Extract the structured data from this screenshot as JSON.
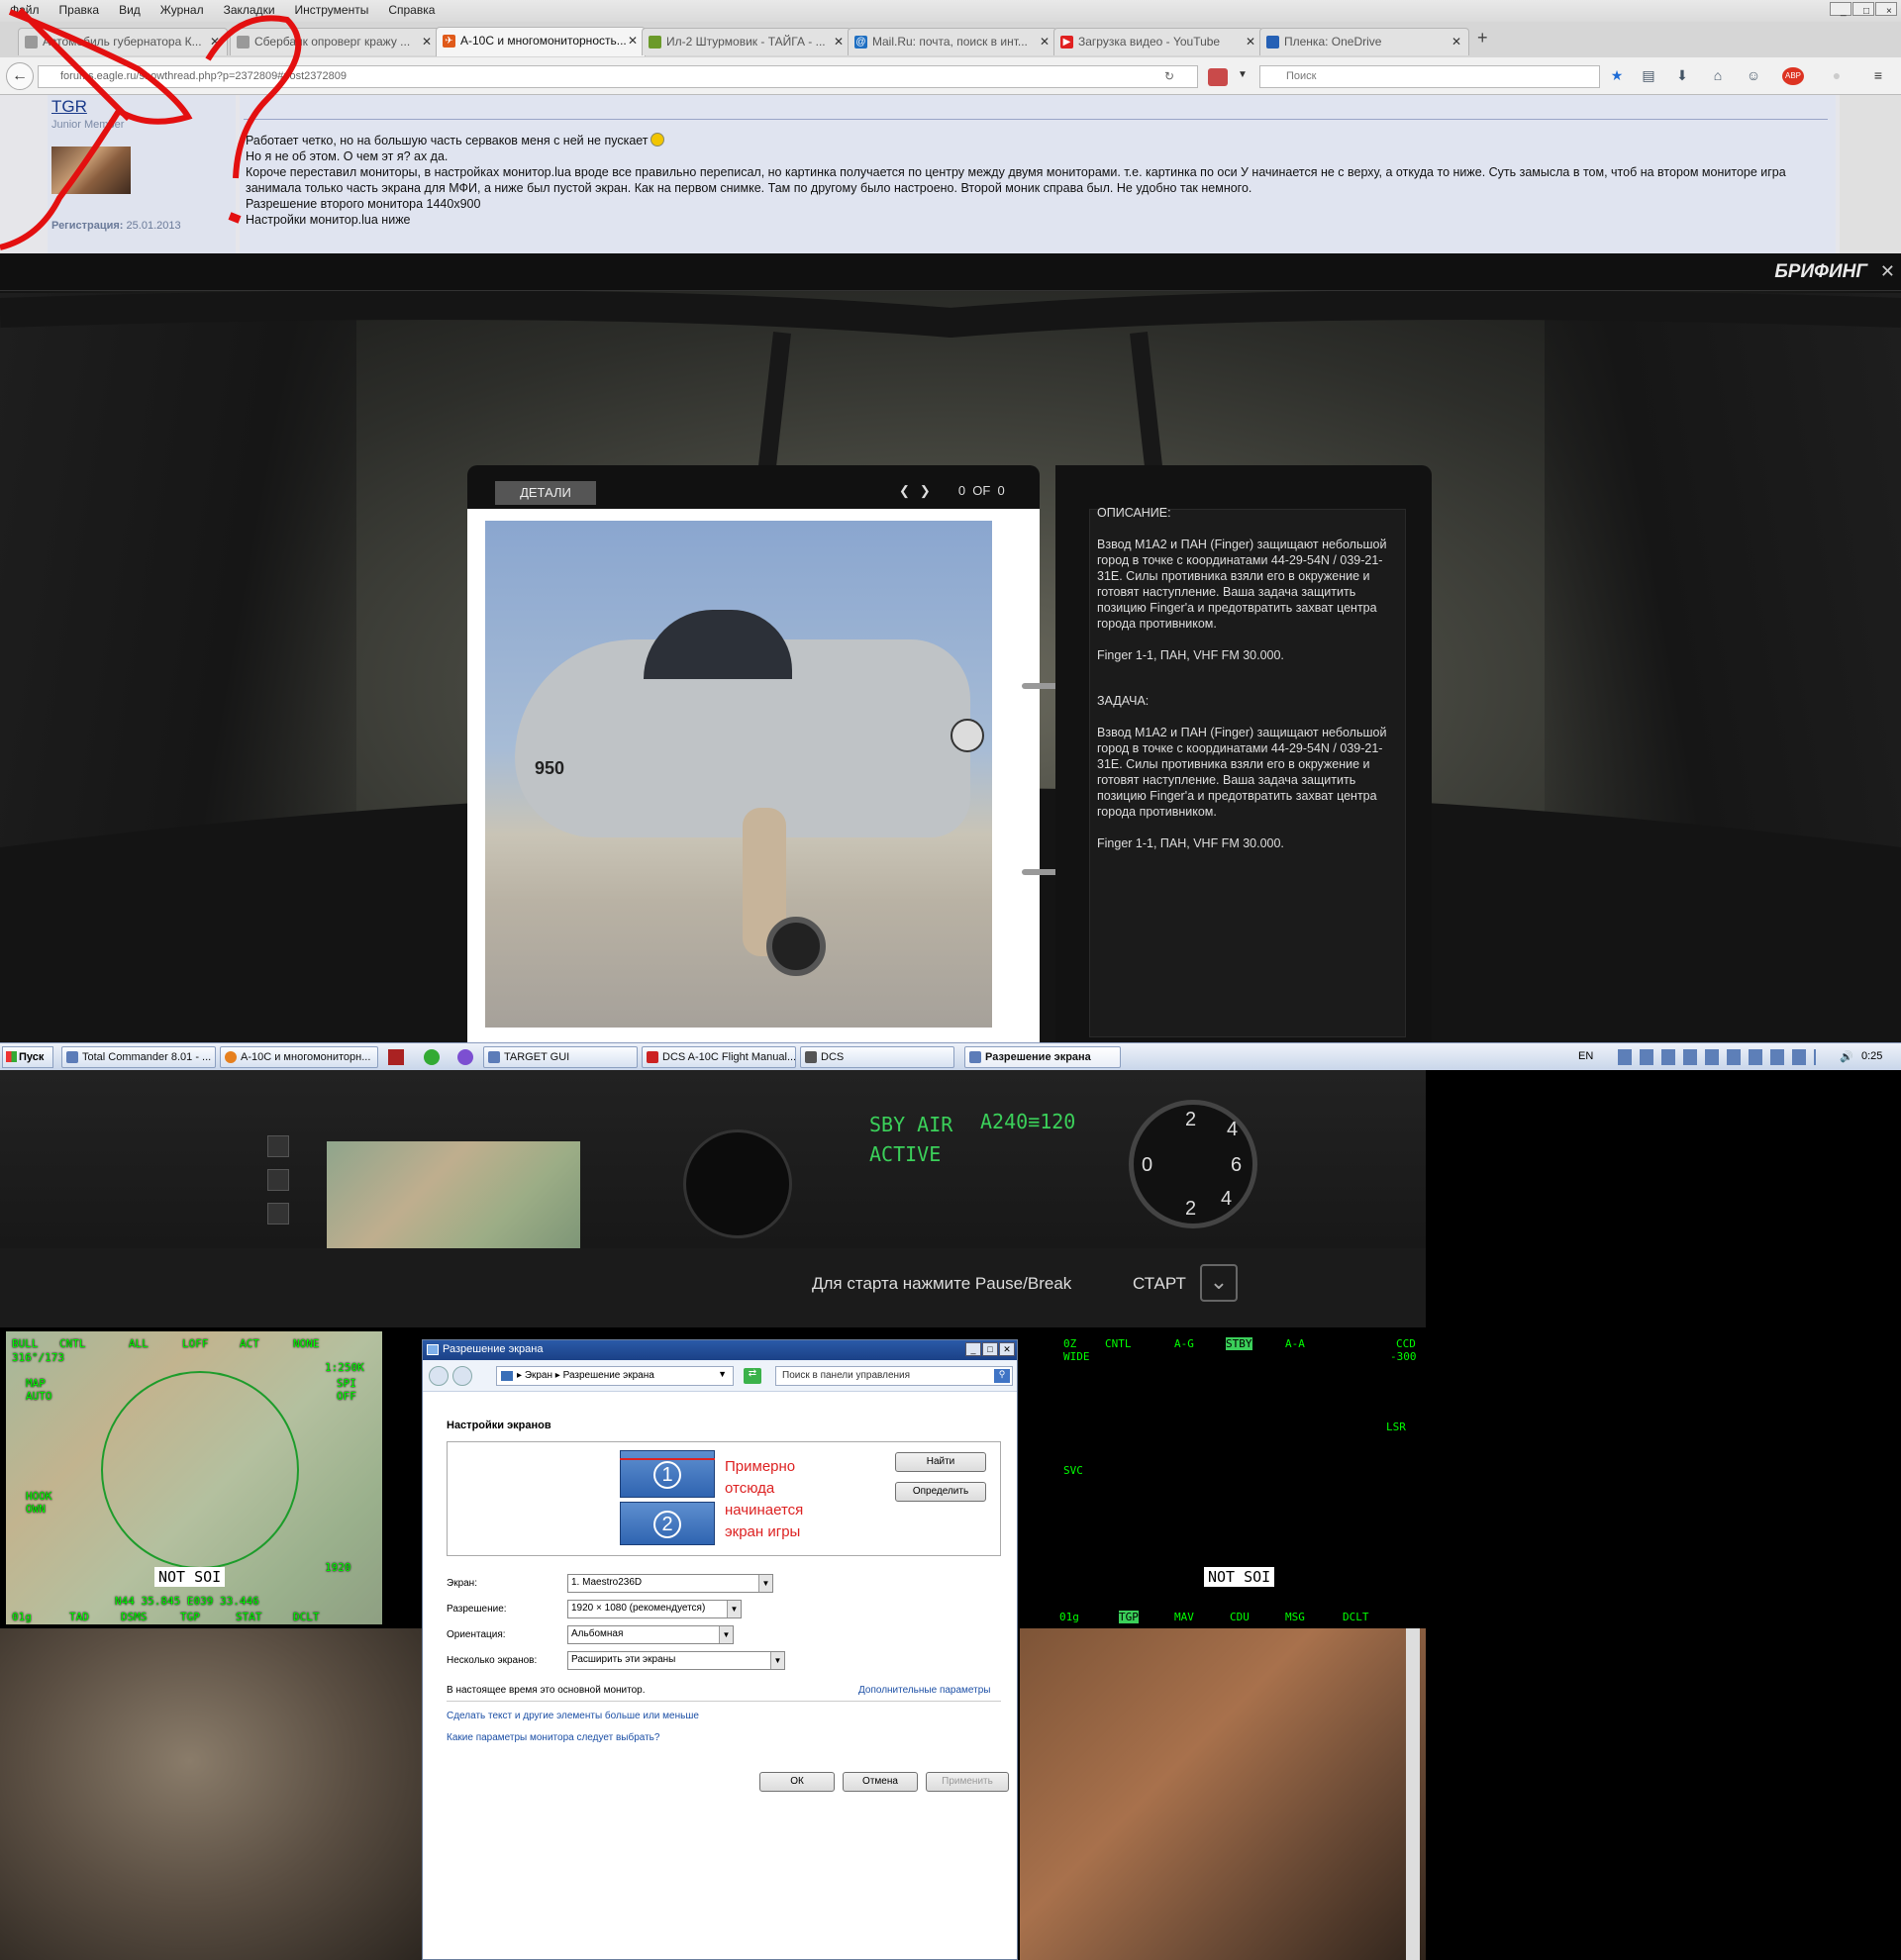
{
  "browser": {
    "menu": [
      "Файл",
      "Правка",
      "Вид",
      "Журнал",
      "Закладки",
      "Инструменты",
      "Справка"
    ],
    "tabs": [
      {
        "label": "Автомобиль губернатора К...",
        "icon": "page-icon"
      },
      {
        "label": "Сбербанк опроверг кражу ...",
        "icon": "page-icon"
      },
      {
        "label": "A-10C и многомониторность...",
        "icon": "eagle-icon",
        "active": true
      },
      {
        "label": "Ил-2 Штурмовик - ТАЙГА - ...",
        "icon": "gamepad-icon"
      },
      {
        "label": "Mail.Ru: почта, поиск в инт...",
        "icon": "mail-icon"
      },
      {
        "label": "Загрузка видео - YouTube",
        "icon": "youtube-icon"
      },
      {
        "label": "Пленка: OneDrive",
        "icon": "cloud-icon"
      }
    ],
    "url": "forums.eagle.ru/showthread.php?p=2372809#post2372809",
    "search_placeholder": "Поиск"
  },
  "forum": {
    "username": "TGR",
    "rank": "Junior Member",
    "reg_label": "Регистрация:",
    "reg_date": "25.01.2013",
    "post_lines": [
      "Работает четко, но на большую часть серваков меня с ней не пускает",
      "Но я не об этом. О чем эт я? ах да.",
      "Короче переставил мониторы, в настройках монитор.lua вроде все правильно переписал, но картинка получается по центру между двумя мониторами. т.е. картинка по оси У начинается не с верху, а откуда то ниже. Суть замысла в том, чтоб на втором мониторе игра занимала только часть экрана для МФИ, а ниже был пустой экран. Как на первом снимке. Там по другому было настроено. Второй моник справа был. Не удобно так немного.",
      "Разрешение второго монитора 1440x900",
      "Настройки монитор.lua ниже"
    ]
  },
  "game": {
    "briefing_title": "БРИФИНГ",
    "details_tab": "ДЕТАЛИ",
    "pager": "0  OF  0",
    "jet_number": "950",
    "description_heading": "ОПИСАНИЕ:",
    "description_text": "Взвод M1A2 и ПАН (Finger) защищают небольшой город в точке с координатами 44-29-54N / 039-21-31E. Силы противника взяли его в окружение и готовят наступление. Ваша задача защитить позицию Finger'a и предотвратить захват центра города противником.",
    "description_freq": "Finger 1-1, ПАН, VHF FM 30.000.",
    "task_heading": "ЗАДАЧА:",
    "task_text": "Взвод M1A2 и ПАН (Finger) защищают небольшой город в точке с координатами 44-29-54N / 039-21-31E. Силы противника взяли его в окружение и готовят наступление. Ваша задача защитить позицию Finger'a и предотвратить захват центра города противником.",
    "task_freq": "Finger 1-1, ПАН, VHF FM 30.000.",
    "start_hint": "Для старта нажмите Pause/Break",
    "start_label": "СТАРТ"
  },
  "taskbar": {
    "start": "Пуск",
    "items": [
      "Total Commander 8.01 - ...",
      "A-10C и многомониторн...",
      "TARGET GUI",
      "DCS A-10C Flight Manual...",
      "DCS",
      "Разрешение экрана"
    ],
    "lang": "EN",
    "clock": "0:25"
  },
  "cockpit": {
    "sby_line1": "SBY AIR",
    "sby_line2": "ACTIVE",
    "cmsp": "A240≡120",
    "gauge_top": "2",
    "gauge_right": "4",
    "gauge_mid": "6",
    "gauge_left": "0",
    "gauge_bot": "2",
    "gauge_bot2": "4"
  },
  "mfd_left": {
    "top": [
      "BULL",
      "CNTL",
      "ALL",
      "LOFF",
      "ACT",
      "NONE"
    ],
    "bull": "316°/173",
    "map": "MAP",
    "auto": "AUTO",
    "hook": "HOOK",
    "own": "OWN",
    "range": "1:250K",
    "spi": "SPI",
    "off": "OFF",
    "notsoi": "NOT SOI",
    "coord": "N44 35.845 E039 33.446",
    "alt": "1920",
    "bottom": [
      "01g",
      "TAD",
      "DSMS",
      "TGP",
      "STAT",
      "DCLT"
    ]
  },
  "mfd_right": {
    "top": [
      "0Z",
      "CNTL",
      "A-G",
      "STBY",
      "A-A",
      "CCD"
    ],
    "wide": "WIDE",
    "ccd_val": "-300",
    "lsr": "LSR",
    "svc": "SVC",
    "notsoi": "NOT SOI",
    "bottom": [
      "01g",
      "TGP",
      "MAV",
      "CDU",
      "MSG",
      "DCLT"
    ]
  },
  "dialog": {
    "title": "Разрешение экрана",
    "bread1": "Экран",
    "bread2": "Разрешение экрана",
    "search": "Поиск в панели управления",
    "heading": "Настройки экранов",
    "mon1": "1",
    "mon2": "2",
    "annotation": [
      "Примерно",
      "отсюда",
      "начинается",
      "экран игры"
    ],
    "find_btn": "Найти",
    "identify_btn": "Определить",
    "screen_label": "Экран:",
    "screen_value": "1. Maestro236D",
    "resolution_label": "Разрешение:",
    "resolution_value": "1920 × 1080 (рекомендуется)",
    "orientation_label": "Ориентация:",
    "orientation_value": "Альбомная",
    "multi_label": "Несколько экранов:",
    "multi_value": "Расширить эти экраны",
    "main_monitor": "В настоящее время это основной монитор.",
    "advanced_link": "Дополнительные параметры",
    "link1": "Сделать текст и другие элементы больше или меньше",
    "link2": "Какие параметры монитора следует выбрать?",
    "ok": "ОК",
    "cancel": "Отмена",
    "apply": "Применить"
  },
  "colors": {
    "mfd_green": "#3bd05a",
    "annotation_red": "#d22222",
    "link_blue": "#1c4fa5"
  }
}
